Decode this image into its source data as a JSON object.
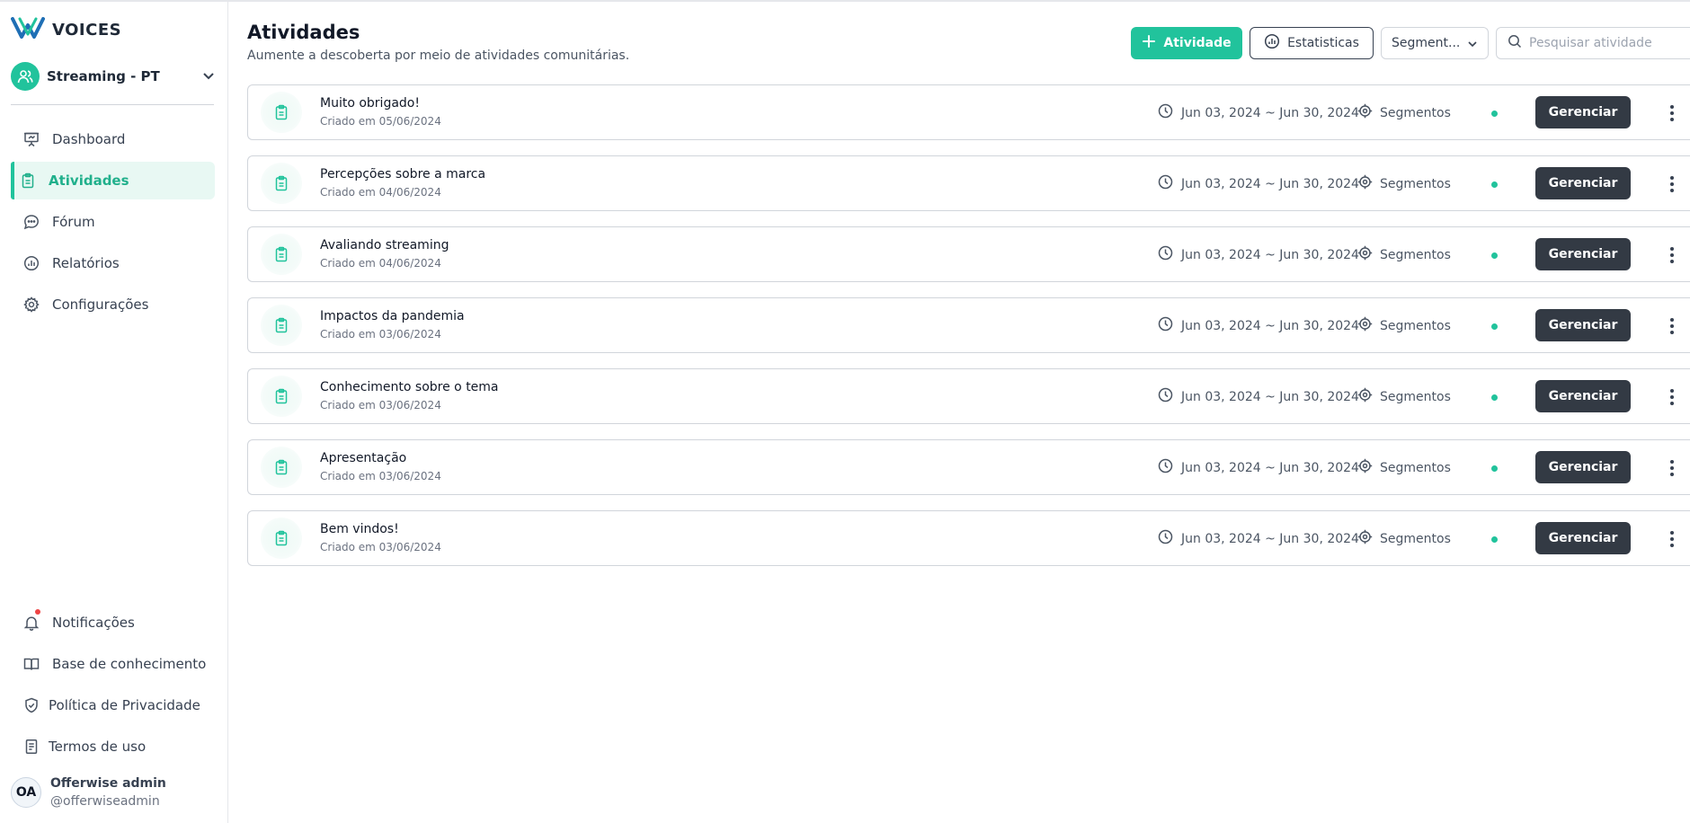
{
  "app": {
    "logo_text": "VOICES",
    "workspace_name": "Streaming - PT"
  },
  "sidebar": {
    "items": [
      {
        "label": "Dashboard",
        "icon": "presentation-icon",
        "active": false
      },
      {
        "label": "Atividades",
        "icon": "clipboard-icon",
        "active": true
      },
      {
        "label": "Fórum",
        "icon": "chat-bubble-icon",
        "active": false
      },
      {
        "label": "Relatórios",
        "icon": "chart-circle-icon",
        "active": false
      },
      {
        "label": "Configurações",
        "icon": "gear-icon",
        "active": false
      }
    ],
    "bottom_items": [
      {
        "label": "Notificações",
        "icon": "bell-icon"
      },
      {
        "label": "Base de conhecimento",
        "icon": "book-icon"
      },
      {
        "label": "Política de Privacidade",
        "icon": "shield-check-icon"
      },
      {
        "label": "Termos de uso",
        "icon": "document-icon"
      }
    ]
  },
  "user": {
    "initials": "OA",
    "name": "Offerwise admin",
    "handle": "@offerwiseadmin"
  },
  "header": {
    "title": "Atividades",
    "subtitle": "Aumente a descoberta por meio de atividades comunitárias.",
    "add_label": "Atividade",
    "stats_label": "Estatisticas",
    "segment_select": "Segment...",
    "search_placeholder": "Pesquisar atividade"
  },
  "colors": {
    "accent": "#21c39c",
    "dark_button": "#333a44",
    "status_active": "#21c39c"
  },
  "activities": [
    {
      "title": "Muito obrigado!",
      "created": "Criado em 05/06/2024",
      "dates": "Jun 03, 2024 ~ Jun 30, 2024",
      "segments": "Segmentos",
      "action": "Gerenciar"
    },
    {
      "title": "Percepções sobre a marca",
      "created": "Criado em 04/06/2024",
      "dates": "Jun 03, 2024 ~ Jun 30, 2024",
      "segments": "Segmentos",
      "action": "Gerenciar"
    },
    {
      "title": "Avaliando streaming",
      "created": "Criado em 04/06/2024",
      "dates": "Jun 03, 2024 ~ Jun 30, 2024",
      "segments": "Segmentos",
      "action": "Gerenciar"
    },
    {
      "title": "Impactos da pandemia",
      "created": "Criado em 03/06/2024",
      "dates": "Jun 03, 2024 ~ Jun 30, 2024",
      "segments": "Segmentos",
      "action": "Gerenciar"
    },
    {
      "title": "Conhecimento sobre o tema",
      "created": "Criado em 03/06/2024",
      "dates": "Jun 03, 2024 ~ Jun 30, 2024",
      "segments": "Segmentos",
      "action": "Gerenciar"
    },
    {
      "title": "Apresentação",
      "created": "Criado em 03/06/2024",
      "dates": "Jun 03, 2024 ~ Jun 30, 2024",
      "segments": "Segmentos",
      "action": "Gerenciar"
    },
    {
      "title": "Bem vindos!",
      "created": "Criado em 03/06/2024",
      "dates": "Jun 03, 2024 ~ Jun 30, 2024",
      "segments": "Segmentos",
      "action": "Gerenciar"
    }
  ]
}
